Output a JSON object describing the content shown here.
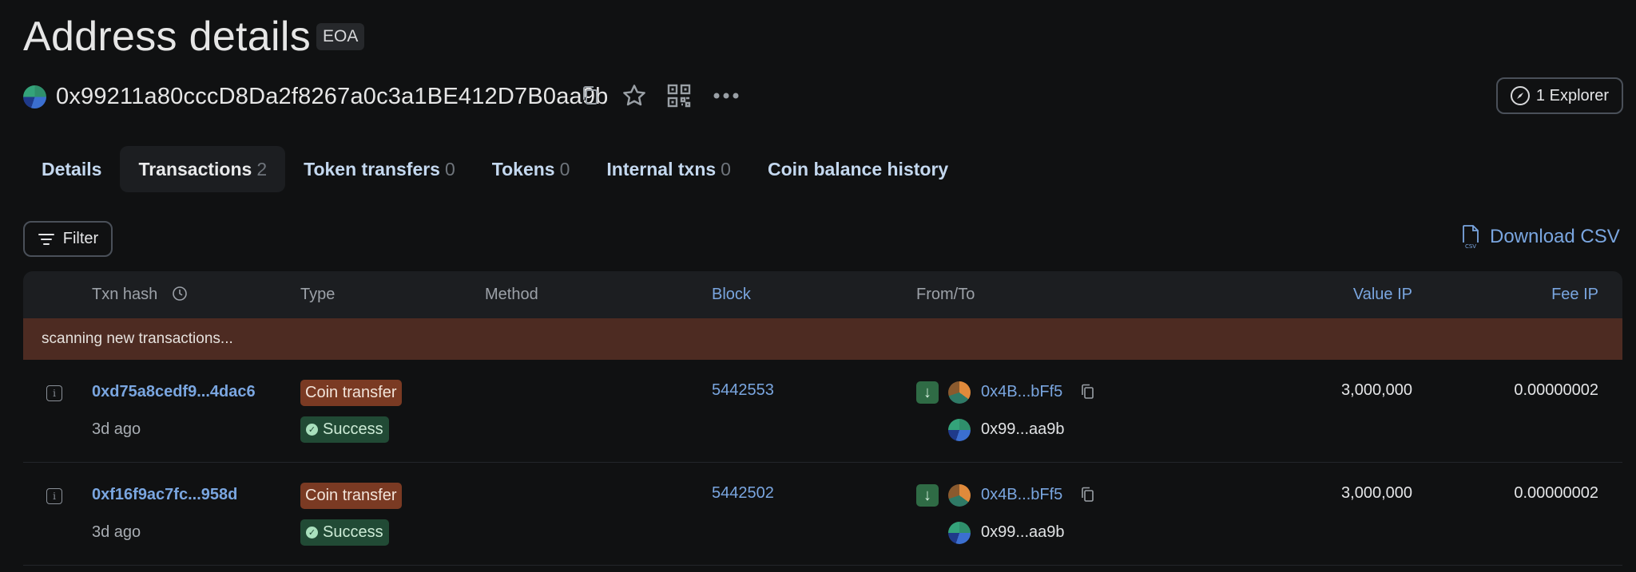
{
  "header": {
    "title": "Address details",
    "badge": "EOA",
    "address": "0x99211a80cccD8Da2f8267a0c3a1BE412D7B0aa9b",
    "explorer_label": "1 Explorer"
  },
  "tabs": [
    {
      "label": "Details",
      "count": ""
    },
    {
      "label": "Transactions",
      "count": "2"
    },
    {
      "label": "Token transfers",
      "count": "0"
    },
    {
      "label": "Tokens",
      "count": "0"
    },
    {
      "label": "Internal txns",
      "count": "0"
    },
    {
      "label": "Coin balance history",
      "count": ""
    }
  ],
  "toolbar": {
    "filter_label": "Filter",
    "download_label": "Download CSV",
    "csv_icon_text": "CSV"
  },
  "table": {
    "headers": {
      "txn_hash": "Txn hash",
      "type": "Type",
      "method": "Method",
      "block": "Block",
      "from_to": "From/To",
      "value": "Value IP",
      "fee": "Fee IP"
    },
    "scanning_text": "scanning new transactions...",
    "rows": [
      {
        "hash": "0xd75a8cedf9...4dac6",
        "age": "3d ago",
        "type": "Coin transfer",
        "status": "Success",
        "block": "5442553",
        "from": "0x4B...bFf5",
        "to": "0x99...aa9b",
        "value": "3,000,000",
        "fee": "0.00000002"
      },
      {
        "hash": "0xf16f9ac7fc...958d",
        "age": "3d ago",
        "type": "Coin transfer",
        "status": "Success",
        "block": "5442502",
        "from": "0x4B...bFf5",
        "to": "0x99...aa9b",
        "value": "3,000,000",
        "fee": "0.00000002"
      }
    ]
  },
  "colors": {
    "background": "#101112",
    "link": "#7aa6e0",
    "scan_bar": "#4d2b22",
    "type_tag": "#7a3a23",
    "success_tag": "#214a35"
  }
}
